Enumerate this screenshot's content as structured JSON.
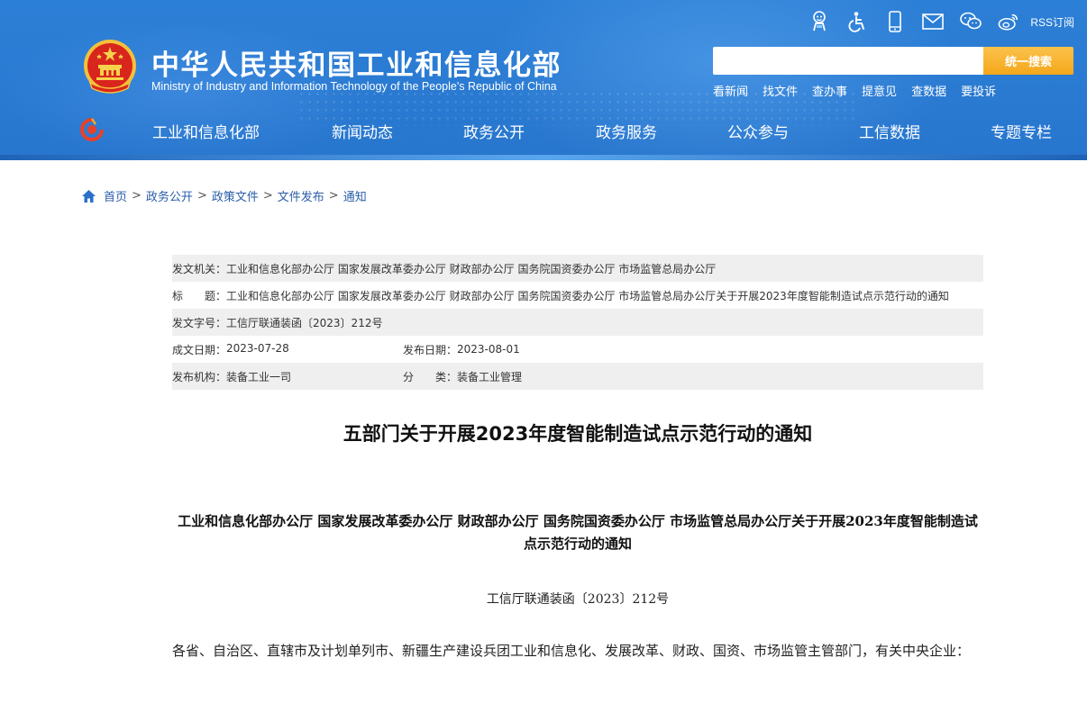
{
  "header": {
    "site_name": "中华人民共和国工业和信息化部",
    "site_name_en": "Ministry of Industry and Information Technology of the People's Republic of China",
    "rss_label": "RSS订阅",
    "search": {
      "placeholder": "",
      "button_label": "统一搜索"
    },
    "quick_links": [
      "看新闻",
      "找文件",
      "查办事",
      "提意见",
      "查数据",
      "要投诉"
    ],
    "nav": [
      "工业和信息化部",
      "新闻动态",
      "政务公开",
      "政务服务",
      "公众参与",
      "工信数据",
      "专题专栏"
    ]
  },
  "breadcrumb": {
    "items": [
      "首页",
      "政务公开",
      "政策文件",
      "文件发布",
      "通知"
    ],
    "separator": ">"
  },
  "meta": {
    "issuer_label": "发文机关：",
    "issuer": "工业和信息化部办公厅 国家发展改革委办公厅 财政部办公厅 国务院国资委办公厅 市场监管总局办公厅",
    "title_label": "标　　题：",
    "title": "工业和信息化部办公厅 国家发展改革委办公厅 财政部办公厅 国务院国资委办公厅 市场监管总局办公厅关于开展2023年度智能制造试点示范行动的通知",
    "doc_no_label": "发文字号：",
    "doc_no": "工信厅联通装函〔2023〕212号",
    "created_label": "成文日期：",
    "created": "2023-07-28",
    "published_label": "发布日期：",
    "published": "2023-08-01",
    "org_label": "发布机构：",
    "org": "装备工业一司",
    "category_label": "分　　类：",
    "category": "装备工业管理"
  },
  "article": {
    "title": "五部门关于开展2023年度智能制造试点示范行动的通知",
    "heading": "工业和信息化部办公厅  国家发展改革委办公厅  财政部办公厅  国务院国资委办公厅  市场监管总局办公厅关于开展2023年度智能制造试点示范行动的通知",
    "doc_number": "工信厅联通装函〔2023〕212号",
    "body_first": "各省、自治区、直辖市及计划单列市、新疆生产建设兵团工业和信息化、发展改革、财政、国资、市场监管主管部门，有关中央企业："
  },
  "colors": {
    "header_blue": "#2a7ad2",
    "search_button": "#f4a71a",
    "breadcrumb_link": "#2a5da8",
    "meta_shade": "#efefef"
  },
  "icons": [
    "accessibility-elder-icon",
    "wheelchair-icon",
    "mobile-icon",
    "mail-icon",
    "wechat-icon",
    "weibo-icon",
    "rss-icon",
    "home-icon",
    "national-emblem-icon",
    "ministry-logo-icon"
  ]
}
